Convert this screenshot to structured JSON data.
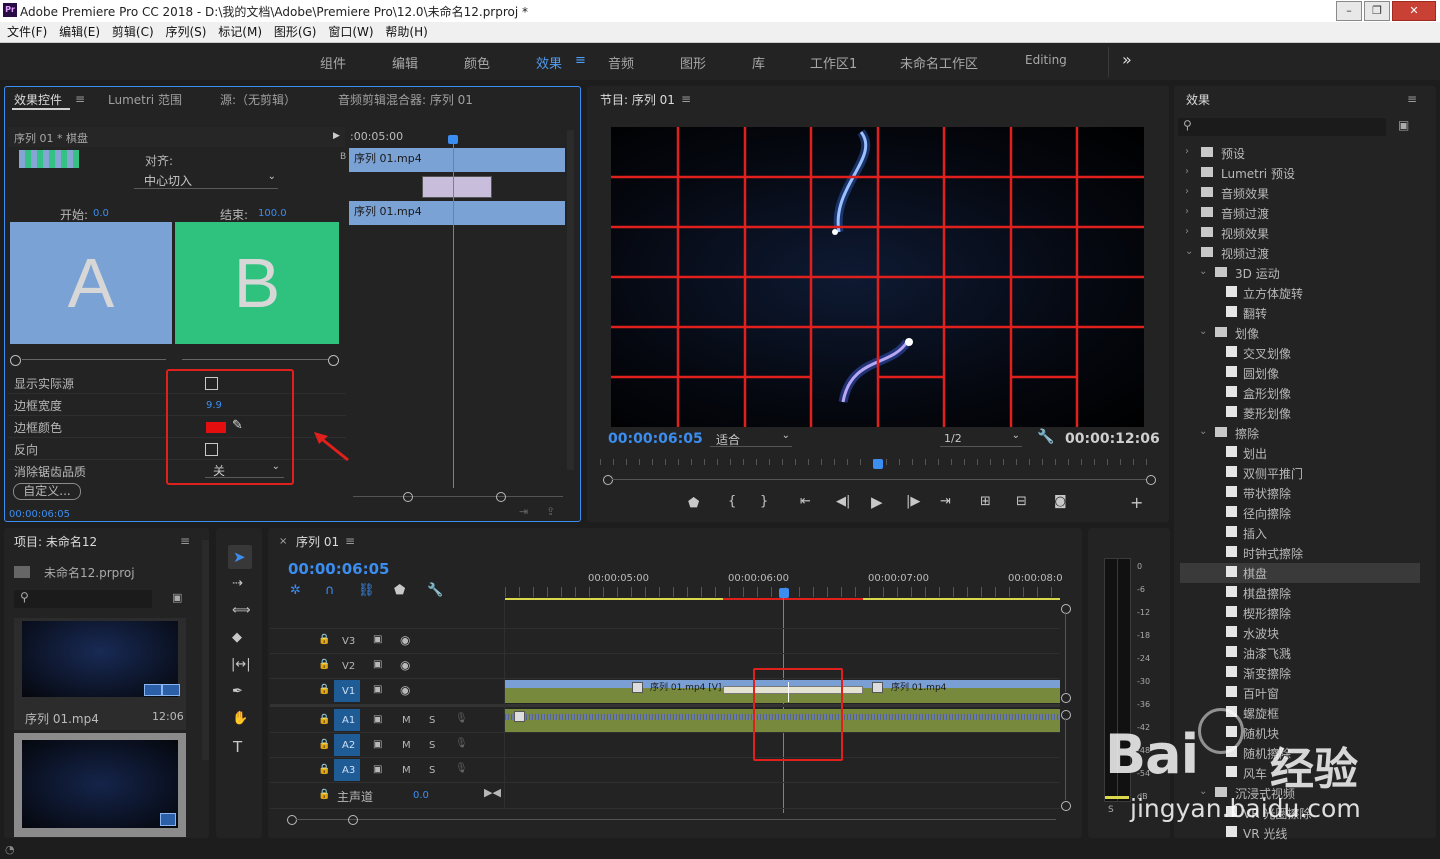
{
  "window": {
    "title": "Adobe Premiere Pro CC 2018 - D:\\我的文档\\Adobe\\Premiere Pro\\12.0\\未命名12.prproj *",
    "logo": "Pr"
  },
  "menu": [
    "文件(F)",
    "编辑(E)",
    "剪辑(C)",
    "序列(S)",
    "标记(M)",
    "图形(G)",
    "窗口(W)",
    "帮助(H)"
  ],
  "workspaces": {
    "items": [
      "组件",
      "编辑",
      "颜色",
      "效果",
      "音频",
      "图形",
      "库",
      "工作区1",
      "未命名工作区",
      "Editing"
    ],
    "active": "效果",
    "more": "»"
  },
  "effect_controls": {
    "tabs": [
      "效果控件",
      "Lumetri 范围",
      "源:（无剪辑）",
      "音频剪辑混合器: 序列 01"
    ],
    "header": "序列 01 * 棋盘",
    "align_label": "对齐:",
    "align_value": "中心切入",
    "start_label": "开始:",
    "start_value": "0.0",
    "end_label": "结束:",
    "end_value": "100.0",
    "preview_a": "A",
    "preview_b": "B",
    "show_source": "显示实际源",
    "border_width": "边框宽度",
    "border_width_value": "9.9",
    "border_color": "边框颜色",
    "reverse": "反向",
    "antialias": "消除锯齿品质",
    "antialias_value": "关",
    "custom_btn": "自定义...",
    "timecode": "00:00:06:05",
    "mini_time": ":00:05:00",
    "clip1": "序列 01.mp4",
    "clip2": "序列 01.mp4"
  },
  "program": {
    "title": "节目: 序列 01",
    "timecode": "00:00:06:05",
    "fit": "适合",
    "quality": "1/2",
    "duration": "00:00:12:06"
  },
  "project": {
    "title": "项目: 未命名12",
    "file": "未命名12.prproj",
    "clip_name": "序列 01.mp4",
    "clip_duration": "12:06"
  },
  "timeline": {
    "title": "序列 01",
    "timecode": "00:00:06:05",
    "ruler": [
      "00:00:05:00",
      "00:00:06:00",
      "00:00:07:00",
      "00:00:08:0"
    ],
    "tracks_v": [
      "V3",
      "V2",
      "V1"
    ],
    "tracks_a": [
      "A1",
      "A2",
      "A3"
    ],
    "master": "主声道",
    "master_value": "0.0",
    "clip_v1a": "序列 01.mp4 [V]",
    "clip_v1b": "序列 01.mp4"
  },
  "meter": {
    "labels": [
      "0",
      "-6",
      "-12",
      "-18",
      "-24",
      "-30",
      "-36",
      "-42",
      "-48",
      "-54",
      "dB"
    ],
    "sm": "S"
  },
  "effects": {
    "title": "效果",
    "items": [
      {
        "label": "预设",
        "level": 0,
        "type": "folder",
        "open": false
      },
      {
        "label": "Lumetri 预设",
        "level": 0,
        "type": "folder",
        "open": false
      },
      {
        "label": "音频效果",
        "level": 0,
        "type": "folder",
        "open": false
      },
      {
        "label": "音频过渡",
        "level": 0,
        "type": "folder",
        "open": false
      },
      {
        "label": "视频效果",
        "level": 0,
        "type": "folder",
        "open": false
      },
      {
        "label": "视频过渡",
        "level": 0,
        "type": "folder",
        "open": true
      },
      {
        "label": "3D 运动",
        "level": 1,
        "type": "folder",
        "open": true
      },
      {
        "label": "立方体旋转",
        "level": 2,
        "type": "fx"
      },
      {
        "label": "翻转",
        "level": 2,
        "type": "fx"
      },
      {
        "label": "划像",
        "level": 1,
        "type": "folder",
        "open": true
      },
      {
        "label": "交叉划像",
        "level": 2,
        "type": "fx"
      },
      {
        "label": "圆划像",
        "level": 2,
        "type": "fx"
      },
      {
        "label": "盒形划像",
        "level": 2,
        "type": "fx"
      },
      {
        "label": "菱形划像",
        "level": 2,
        "type": "fx"
      },
      {
        "label": "擦除",
        "level": 1,
        "type": "folder",
        "open": true
      },
      {
        "label": "划出",
        "level": 2,
        "type": "fx"
      },
      {
        "label": "双侧平推门",
        "level": 2,
        "type": "fx"
      },
      {
        "label": "带状擦除",
        "level": 2,
        "type": "fx"
      },
      {
        "label": "径向擦除",
        "level": 2,
        "type": "fx"
      },
      {
        "label": "插入",
        "level": 2,
        "type": "fx"
      },
      {
        "label": "时钟式擦除",
        "level": 2,
        "type": "fx"
      },
      {
        "label": "棋盘",
        "level": 2,
        "type": "fx",
        "selected": true
      },
      {
        "label": "棋盘擦除",
        "level": 2,
        "type": "fx"
      },
      {
        "label": "楔形擦除",
        "level": 2,
        "type": "fx"
      },
      {
        "label": "水波块",
        "level": 2,
        "type": "fx"
      },
      {
        "label": "油漆飞溅",
        "level": 2,
        "type": "fx"
      },
      {
        "label": "渐变擦除",
        "level": 2,
        "type": "fx"
      },
      {
        "label": "百叶窗",
        "level": 2,
        "type": "fx"
      },
      {
        "label": "螺旋框",
        "level": 2,
        "type": "fx"
      },
      {
        "label": "随机块",
        "level": 2,
        "type": "fx"
      },
      {
        "label": "随机擦除",
        "level": 2,
        "type": "fx"
      },
      {
        "label": "风车",
        "level": 2,
        "type": "fx"
      },
      {
        "label": "沉浸式视频",
        "level": 1,
        "type": "folder",
        "open": true
      },
      {
        "label": "VR 光圈擦除",
        "level": 2,
        "type": "fx"
      },
      {
        "label": "VR 光线",
        "level": 2,
        "type": "fx"
      }
    ]
  },
  "watermark": {
    "brand": "Bai",
    "brand2": "经验",
    "url": "jingyan.baidu.com"
  },
  "colors": {
    "accent": "#3b8df0",
    "highlight": "#e0201c",
    "clip": "#7a9fd4",
    "audio": "#76893d"
  }
}
